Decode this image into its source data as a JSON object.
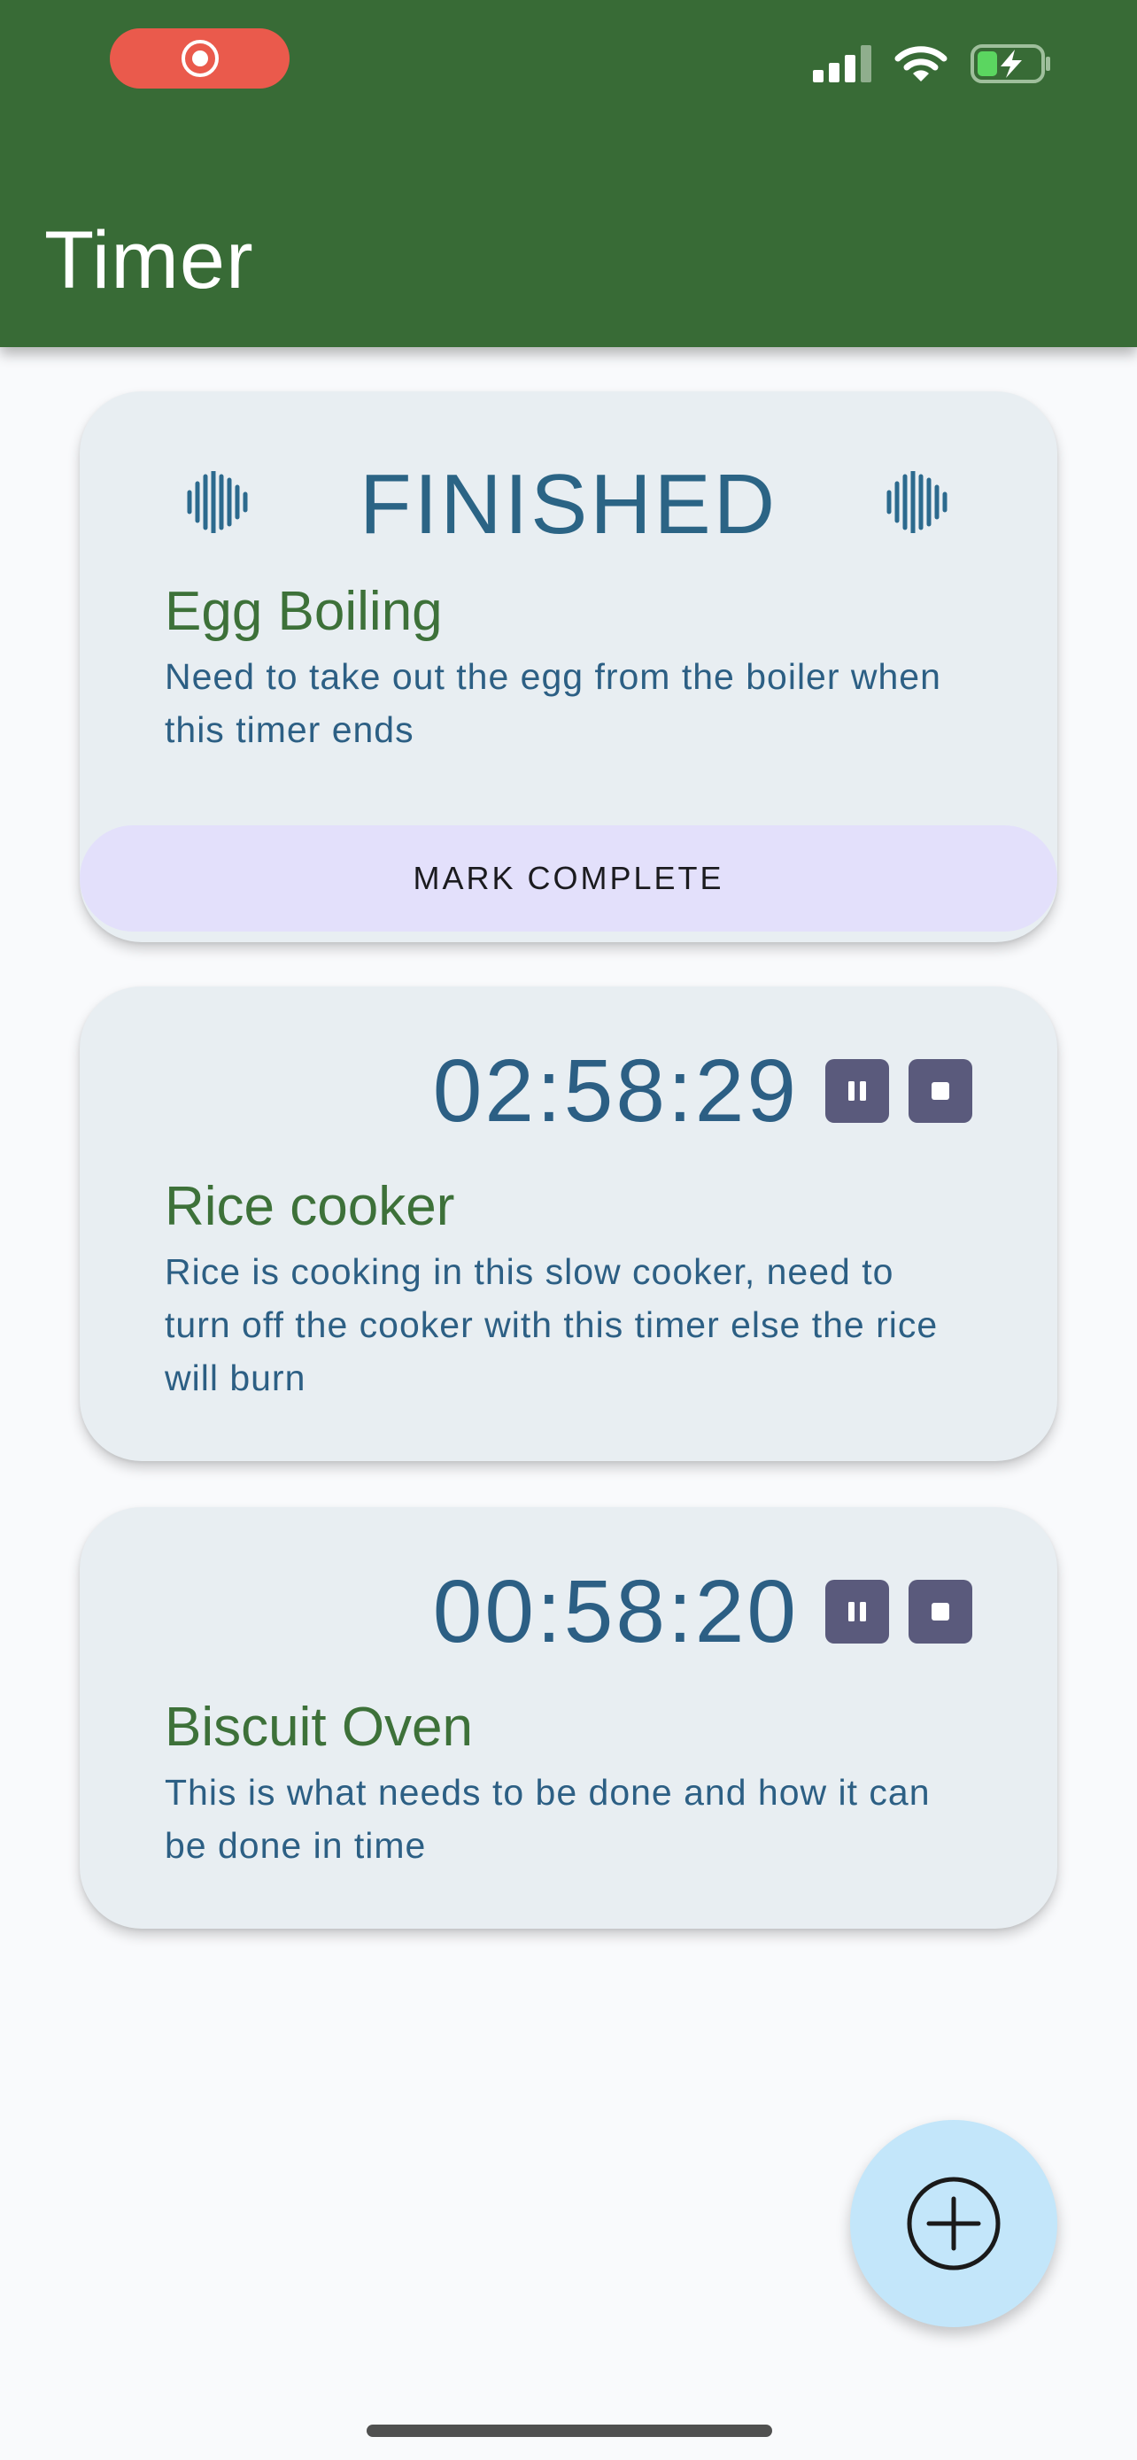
{
  "app": {
    "title": "Timer"
  },
  "status_bar": {
    "recording_icon": "record-icon",
    "signal_icon": "cellular-signal-icon",
    "wifi_icon": "wifi-icon",
    "battery_icon": "battery-charging-icon"
  },
  "timers": [
    {
      "state": "finished",
      "status_label": "FINISHED",
      "title": "Egg Boiling",
      "description": "Need to take out the egg from the boiler when this timer ends",
      "action_label": "MARK COMPLETE"
    },
    {
      "state": "running",
      "time": "02:58:29",
      "title": "Rice cooker",
      "description": "Rice is cooking in this slow cooker, need to turn off the cooker with this timer else the rice will burn"
    },
    {
      "state": "running",
      "time": "00:58:20",
      "title": "Biscuit Oven",
      "description": "This is what needs to be done and how it can be done in time"
    }
  ],
  "fab": {
    "icon": "add-circle-icon"
  },
  "colors": {
    "app_bar": "#386b36",
    "card_bg": "#e8eef2",
    "title_green": "#3d7139",
    "text_blue": "#2c5f84",
    "button_purple": "#e3e0fb",
    "control_bg": "#5a5a7c",
    "fab_bg": "#c3e6fa",
    "record_red": "#ea5a4c"
  }
}
